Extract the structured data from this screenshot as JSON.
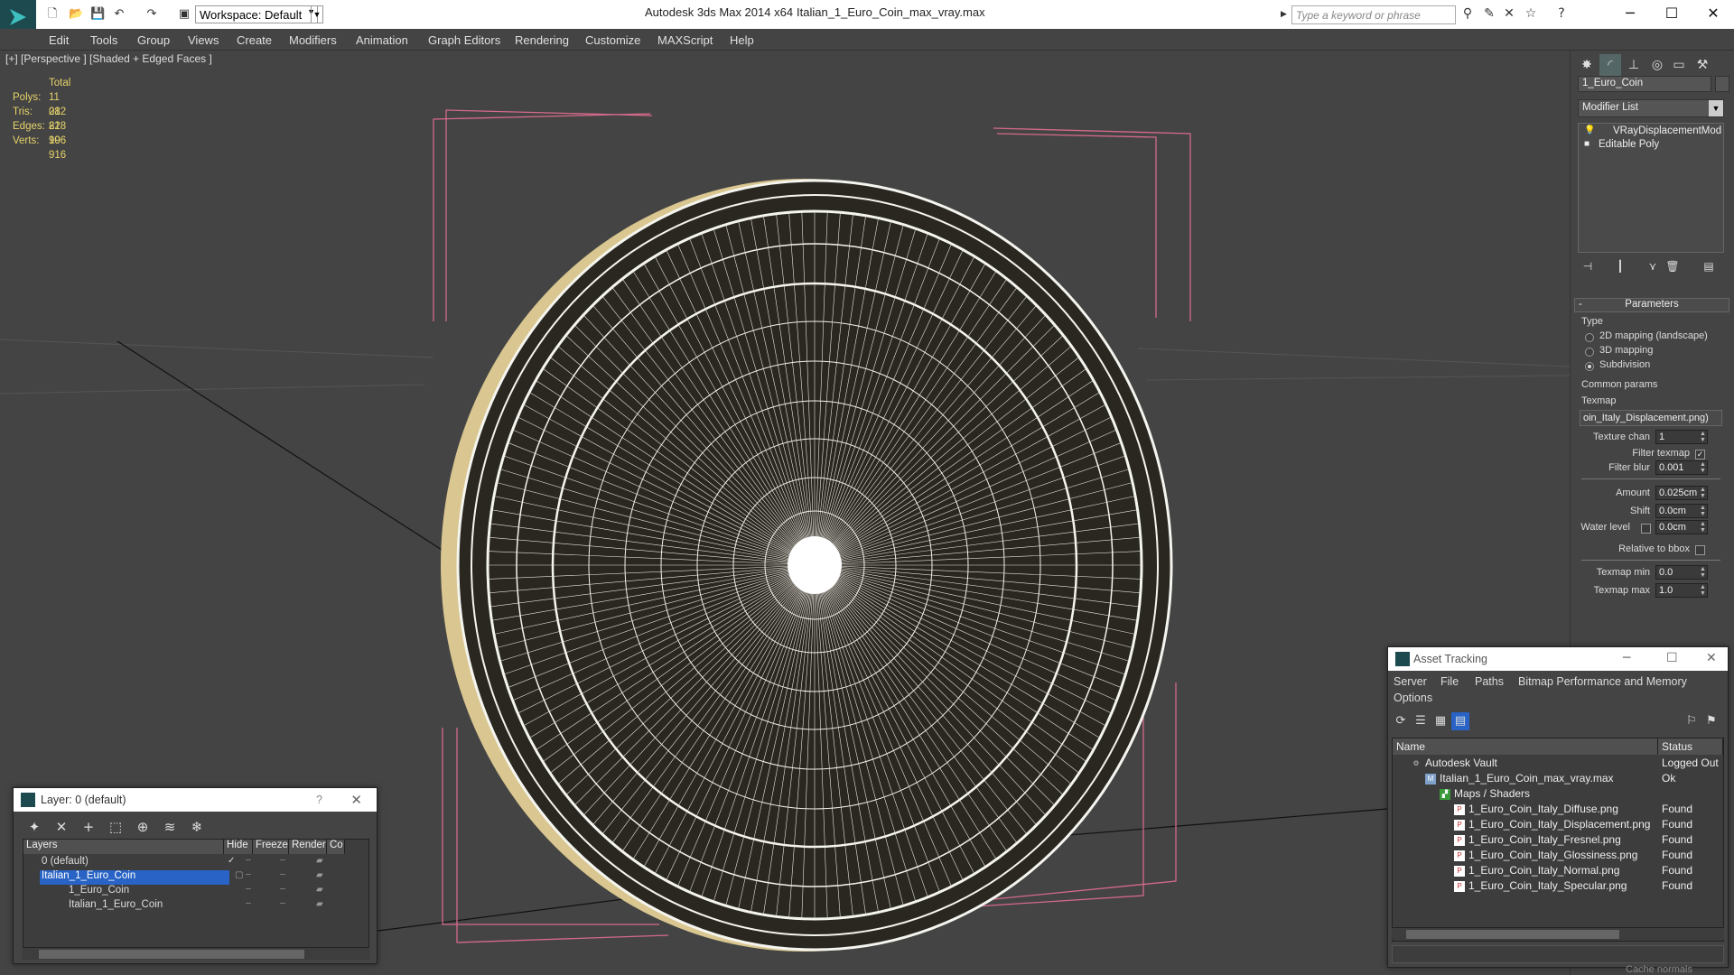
{
  "titlebar": {
    "workspace": "Workspace: Default",
    "app_title": "Autodesk 3ds Max 2014 x64",
    "file_title": "Italian_1_Euro_Coin_max_vray.max",
    "search_placeholder": "Type a keyword or phrase",
    "minimize": "─",
    "maximize": "☐",
    "close": "✕"
  },
  "menu": [
    "Edit",
    "Tools",
    "Group",
    "Views",
    "Create",
    "Modifiers",
    "Animation",
    "Graph Editors",
    "Rendering",
    "Customize",
    "MAXScript",
    "Help"
  ],
  "viewport": {
    "label": "[+] [Perspective ] [Shaded + Edged Faces ]",
    "stats_header": "Total",
    "stats": [
      {
        "k": "Polys:",
        "v": "11 082"
      },
      {
        "k": "Tris:",
        "v": "21 828"
      },
      {
        "k": "Edges:",
        "v": "21 996"
      },
      {
        "k": "Verts:",
        "v": "10 916"
      }
    ]
  },
  "command_panel": {
    "object_name": "1_Euro_Coin",
    "modifier_list": "Modifier List",
    "stack": [
      "VRayDisplacementMod",
      "Editable Poly"
    ],
    "rollout_title": "Parameters",
    "type_label": "Type",
    "type_options": [
      "2D mapping (landscape)",
      "3D mapping",
      "Subdivision"
    ],
    "type_selected": "Subdivision",
    "common_params_label": "Common params",
    "texmap_label": "Texmap",
    "texmap_value": "oin_Italy_Displacement.png)",
    "texture_chan_label": "Texture chan",
    "texture_chan_value": "1",
    "filter_texmap_label": "Filter texmap",
    "filter_blur_label": "Filter blur",
    "filter_blur_value": "0.001",
    "amount_label": "Amount",
    "amount_value": "0.025cm",
    "shift_label": "Shift",
    "shift_value": "0.0cm",
    "water_level_label": "Water level",
    "water_level_value": "0.0cm",
    "relative_bbox_label": "Relative to bbox",
    "texmap_min_label": "Texmap min",
    "texmap_min_value": "0.0",
    "texmap_max_label": "Texmap max",
    "texmap_max_value": "1.0"
  },
  "layer_dialog": {
    "title": "Layer: 0 (default)",
    "help": "?",
    "close": "✕",
    "columns": [
      "Layers",
      "Hide",
      "Freeze",
      "Render",
      "Co"
    ],
    "rows": [
      {
        "name": "0 (default)",
        "selected": false
      },
      {
        "name": "Italian_1_Euro_Coin",
        "selected": true
      },
      {
        "name": "1_Euro_Coin",
        "selected": false
      },
      {
        "name": "Italian_1_Euro_Coin",
        "selected": false
      }
    ]
  },
  "asset_tracking": {
    "title": "Asset Tracking",
    "menu": [
      "Server",
      "File",
      "Paths",
      "Bitmap Performance and Memory",
      "Options"
    ],
    "columns": [
      "Name",
      "Status"
    ],
    "rows": [
      {
        "name": "Autodesk Vault",
        "status": "Logged Out"
      },
      {
        "name": "Italian_1_Euro_Coin_max_vray.max",
        "status": "Ok"
      },
      {
        "name": "Maps / Shaders",
        "status": ""
      },
      {
        "name": "1_Euro_Coin_Italy_Diffuse.png",
        "status": "Found"
      },
      {
        "name": "1_Euro_Coin_Italy_Displacement.png",
        "status": "Found"
      },
      {
        "name": "1_Euro_Coin_Italy_Fresnel.png",
        "status": "Found"
      },
      {
        "name": "1_Euro_Coin_Italy_Glossiness.png",
        "status": "Found"
      },
      {
        "name": "1_Euro_Coin_Italy_Normal.png",
        "status": "Found"
      },
      {
        "name": "1_Euro_Coin_Italy_Specular.png",
        "status": "Found"
      }
    ]
  },
  "status_bar": {
    "cache_normals": "Cache normals"
  },
  "colors": {
    "accent": "#2863c5",
    "stats_yellow": "#e6d36a",
    "bbox_pink": "#d56a8a",
    "viewport_bg": "#444444"
  }
}
